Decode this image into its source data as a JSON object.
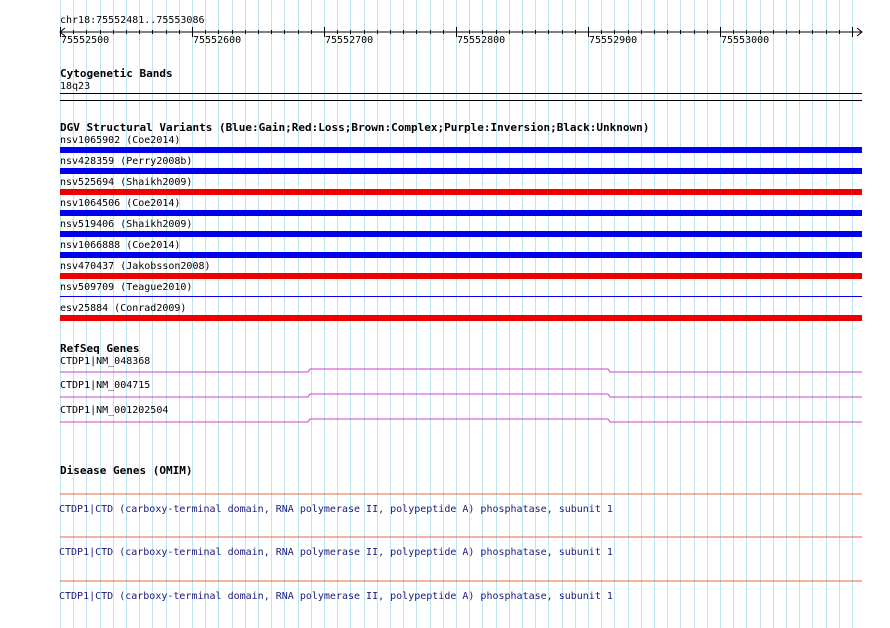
{
  "ruler": {
    "location": "chr18:75552481..75553086",
    "ticks": [
      "75552500",
      "75552600",
      "75552700",
      "75552800",
      "75552900",
      "75553000"
    ]
  },
  "cytoband": {
    "title": "Cytogenetic Bands",
    "band": "18q23"
  },
  "dgv": {
    "title": "DGV Structural Variants (Blue:Gain;Red:Loss;Brown:Complex;Purple:Inversion;Black:Unknown)",
    "colors": {
      "gain": "#0000ee",
      "loss": "#ee0000"
    },
    "variants": [
      {
        "label": "nsv1065902 (Coe2014)",
        "type": "gain"
      },
      {
        "label": "nsv428359 (Perry2008b)",
        "type": "gain"
      },
      {
        "label": "nsv525694 (Shaikh2009)",
        "type": "loss"
      },
      {
        "label": "nsv1064506 (Coe2014)",
        "type": "gain"
      },
      {
        "label": "nsv519406 (Shaikh2009)",
        "type": "gain"
      },
      {
        "label": "nsv1066888 (Coe2014)",
        "type": "gain"
      },
      {
        "label": "nsv470437 (Jakobsson2008)",
        "type": "loss"
      },
      {
        "label": "nsv509709 (Teague2010)",
        "type": "gain-thin"
      },
      {
        "label": "esv25884 (Conrad2009)",
        "type": "loss"
      }
    ]
  },
  "refseq": {
    "title": "RefSeq Genes",
    "color": "#cc44cc",
    "genes": [
      {
        "label": "CTDP1|NM_048368"
      },
      {
        "label": "CTDP1|NM_004715"
      },
      {
        "label": "CTDP1|NM_001202504"
      }
    ]
  },
  "omim": {
    "title": "Disease Genes (OMIM)",
    "color": "#ee6644",
    "genes": [
      {
        "label": "CTDP1|CTD (carboxy-terminal domain, RNA polymerase II, polypeptide A) phosphatase, subunit 1"
      },
      {
        "label": "CTDP1|CTD (carboxy-terminal domain, RNA polymerase II, polypeptide A) phosphatase, subunit 1"
      },
      {
        "label": "CTDP1|CTD (carboxy-terminal domain, RNA polymerase II, polypeptide A) phosphatase, subunit 1"
      }
    ]
  }
}
